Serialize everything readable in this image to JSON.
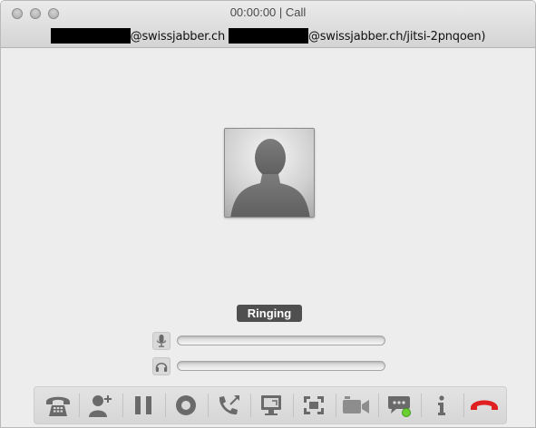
{
  "window": {
    "title": "00:00:00 | Call",
    "participants": {
      "domain_a": "@swissjabber.ch",
      "domain_b": "@swissjabber.ch/jitsi-2pnqoen)"
    }
  },
  "call": {
    "status": "Ringing"
  },
  "meters": [
    {
      "icon": "microphone-icon",
      "level": 0
    },
    {
      "icon": "headphones-icon",
      "level": 0
    }
  ],
  "toolbar": {
    "buttons": [
      {
        "icon": "dialpad-icon"
      },
      {
        "icon": "add-participant-icon"
      },
      {
        "icon": "pause-icon"
      },
      {
        "icon": "record-icon"
      },
      {
        "icon": "transfer-call-icon"
      },
      {
        "icon": "desktop-share-icon"
      },
      {
        "icon": "fullscreen-icon"
      },
      {
        "icon": "video-icon"
      },
      {
        "icon": "chat-icon"
      },
      {
        "icon": "info-icon"
      },
      {
        "icon": "hangup-icon"
      }
    ]
  },
  "colors": {
    "hangup": "#e02020",
    "chat_online": "#6bcf32",
    "icon_gray": "#6a6a6a"
  }
}
